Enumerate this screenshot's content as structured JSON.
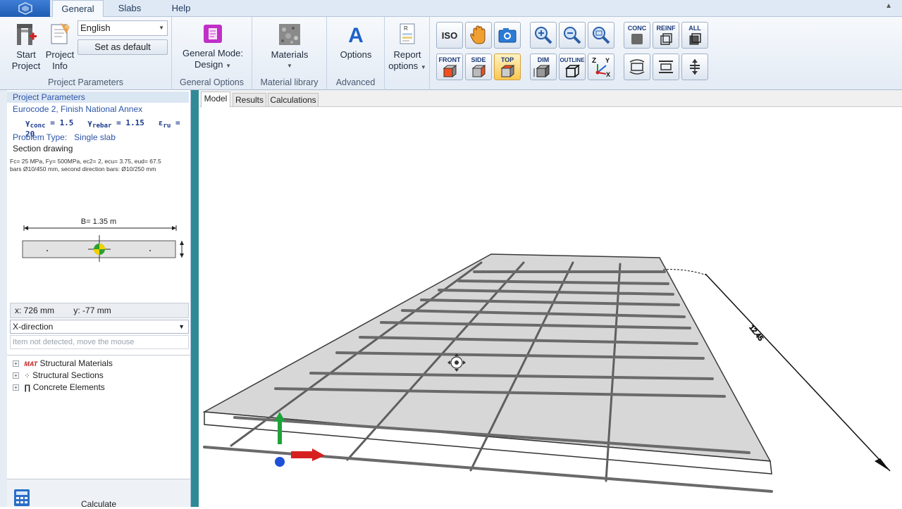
{
  "tabs": [
    {
      "label": "General",
      "active": true
    },
    {
      "label": "Slabs",
      "active": false
    },
    {
      "label": "Help",
      "active": false
    }
  ],
  "ribbon": {
    "project_params": {
      "start_project": [
        "Start",
        "Project"
      ],
      "project_info": [
        "Project",
        "Info"
      ],
      "language": "English",
      "set_default": "Set as default",
      "group_label": "Project Parameters"
    },
    "general_options": {
      "mode_label": "General Mode:",
      "mode_value": "Design",
      "group_label": "General Options"
    },
    "material_library": {
      "materials": "Materials",
      "group_label": "Material library"
    },
    "advanced": {
      "options": "Options",
      "group_label": "Advanced"
    },
    "report": {
      "label": [
        "Report",
        "options"
      ]
    },
    "view_tools": {
      "iso": "ISO",
      "front": "FRONT",
      "side": "SIDE",
      "top": "TOP",
      "dim": "DIM",
      "outline": "OUTLINE",
      "conc": "CONC",
      "reinf": "REINF",
      "all": "ALL"
    }
  },
  "left": {
    "header": "Project Parameters",
    "code": "Eurocode 2, Finish National Annex",
    "gamma_conc": "1.5",
    "gamma_rebar": "1.15",
    "eps_ru": "20",
    "problem_label": "Problem Type:",
    "problem_value": "Single slab",
    "section_title": "Section drawing",
    "section_line1": "Fc= 25 MPa, Fy= 500MPa, ec2= 2, ecu= 3.75, eud= 67.5",
    "section_line2": "bars Ø10/450 mm, second direction bars: Ø10/250 mm",
    "width_label": "B= 1.35 m",
    "coord_x": "x: 726 mm",
    "coord_y": "y: -77 mm",
    "direction": "X-direction",
    "hint": "Item not detected, move the mouse",
    "tree": [
      {
        "label": "Structural Materials",
        "icon": "mat-icon"
      },
      {
        "label": "Structural Sections",
        "icon": "sections-icon"
      },
      {
        "label": "Concrete Elements",
        "icon": "element-icon"
      }
    ],
    "calculate": "Calculate"
  },
  "view_tabs": [
    "Model",
    "Results",
    "Calculations"
  ],
  "colors": {
    "accent": "#2f8a96",
    "ribbon_bg": "#e3ebf5",
    "slab_fill": "#d9d9d9",
    "rebar": "#6b6b6b"
  }
}
